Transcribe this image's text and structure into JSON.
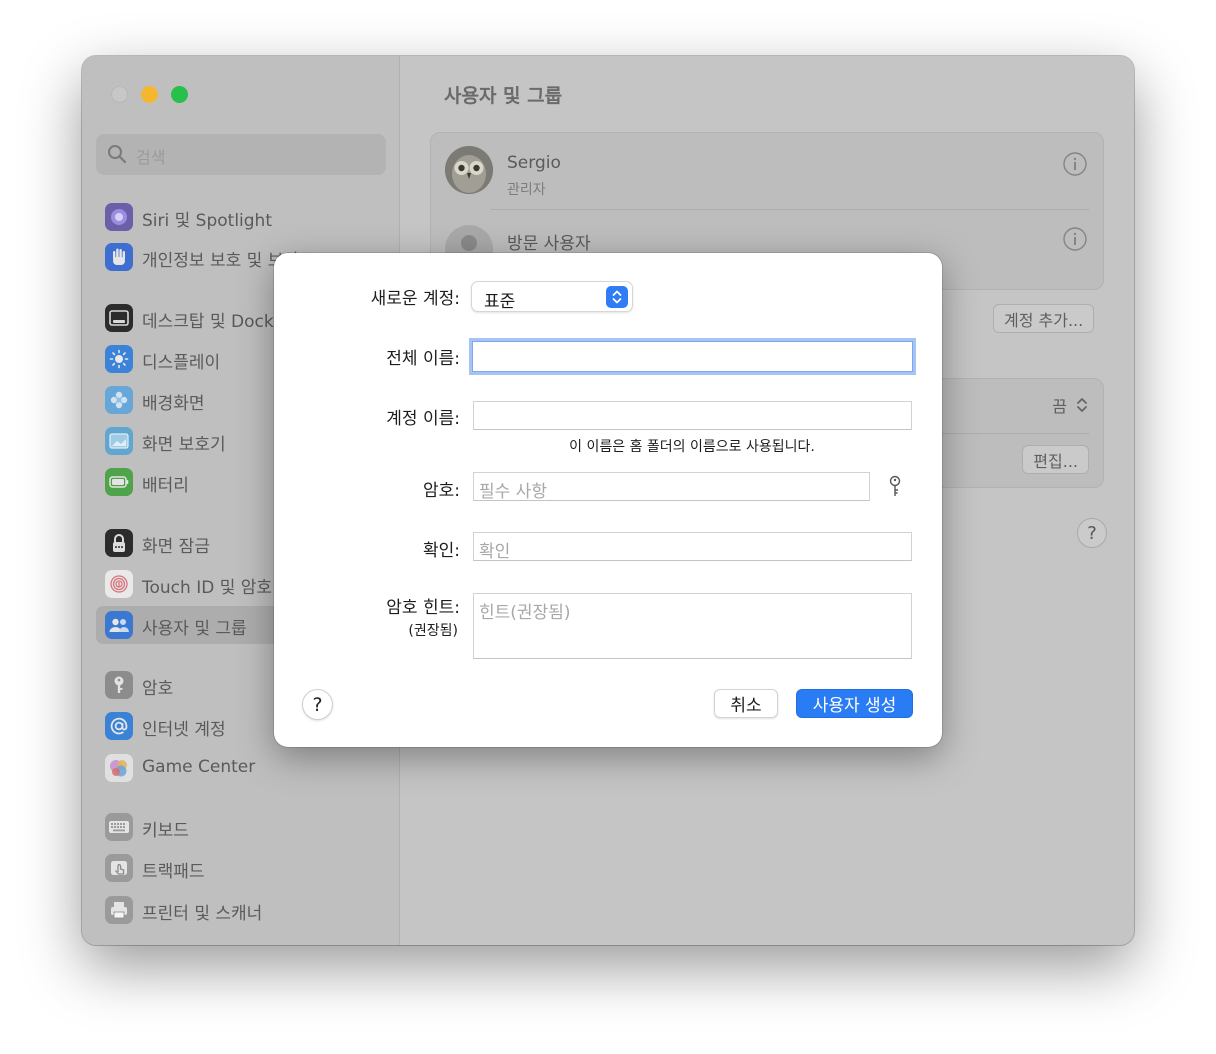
{
  "sidebar": {
    "search_placeholder": "검색",
    "items": [
      {
        "label": "Siri 및 Spotlight",
        "icon": "siri-icon",
        "color": "#6c5ea8"
      },
      {
        "label": "개인정보 보호 및 보안",
        "icon": "hand-icon",
        "color": "#3e6ed0"
      },
      {
        "label": "데스크탑 및 Dock",
        "icon": "dock-icon",
        "color": "#2c2c2c"
      },
      {
        "label": "디스플레이",
        "icon": "sun-icon",
        "color": "#3b83d8"
      },
      {
        "label": "배경화면",
        "icon": "flower-icon",
        "color": "#66a7d8"
      },
      {
        "label": "화면 보호기",
        "icon": "screensaver-icon",
        "color": "#62a6cf"
      },
      {
        "label": "배터리",
        "icon": "battery-icon",
        "color": "#4fa34a"
      },
      {
        "label": "화면 잠금",
        "icon": "lock-icon",
        "color": "#2c2c2c"
      },
      {
        "label": "Touch ID 및 암호",
        "icon": "fingerprint-icon",
        "color": "#e9e9e9"
      },
      {
        "label": "사용자 및 그룹",
        "icon": "users-icon",
        "color": "#3a78d2"
      },
      {
        "label": "암호",
        "icon": "key-icon",
        "color": "#8c8c8c"
      },
      {
        "label": "인터넷 계정",
        "icon": "at-icon",
        "color": "#3a82d6"
      },
      {
        "label": "Game Center",
        "icon": "game-center-icon",
        "color": "#e0e0e0"
      },
      {
        "label": "키보드",
        "icon": "keyboard-icon",
        "color": "#9a9a9a"
      },
      {
        "label": "트랙패드",
        "icon": "trackpad-icon",
        "color": "#9a9a9a"
      },
      {
        "label": "프린터 및 스캐너",
        "icon": "printer-icon",
        "color": "#9a9a9a"
      }
    ]
  },
  "main": {
    "title": "사용자 및 그룹",
    "users": [
      {
        "name": "Sergio",
        "role": "관리자"
      },
      {
        "name": "방문 사용자",
        "role": ""
      }
    ],
    "add_account_label": "계정 추가...",
    "auto_login_value": "끔",
    "edit_label": "편집...",
    "help_label": "?"
  },
  "dialog": {
    "account_type_label": "새로운 계정:",
    "account_type_value": "표준",
    "full_name_label": "전체 이름:",
    "full_name_value": "",
    "account_name_label": "계정 이름:",
    "account_name_value": "",
    "account_name_caption": "이 이름은 홈 폴더의 이름으로 사용됩니다.",
    "password_label": "암호:",
    "password_placeholder": "필수 사항",
    "verify_label": "확인:",
    "verify_placeholder": "확인",
    "hint_label": "암호 힌트:",
    "hint_sublabel": "(권장됨)",
    "hint_placeholder": "힌트(권장됨)",
    "help_label": "?",
    "cancel_label": "취소",
    "create_label": "사용자 생성"
  },
  "colors": {
    "accent": "#2a7cf4",
    "focus_ring": "#a6c3f5"
  }
}
